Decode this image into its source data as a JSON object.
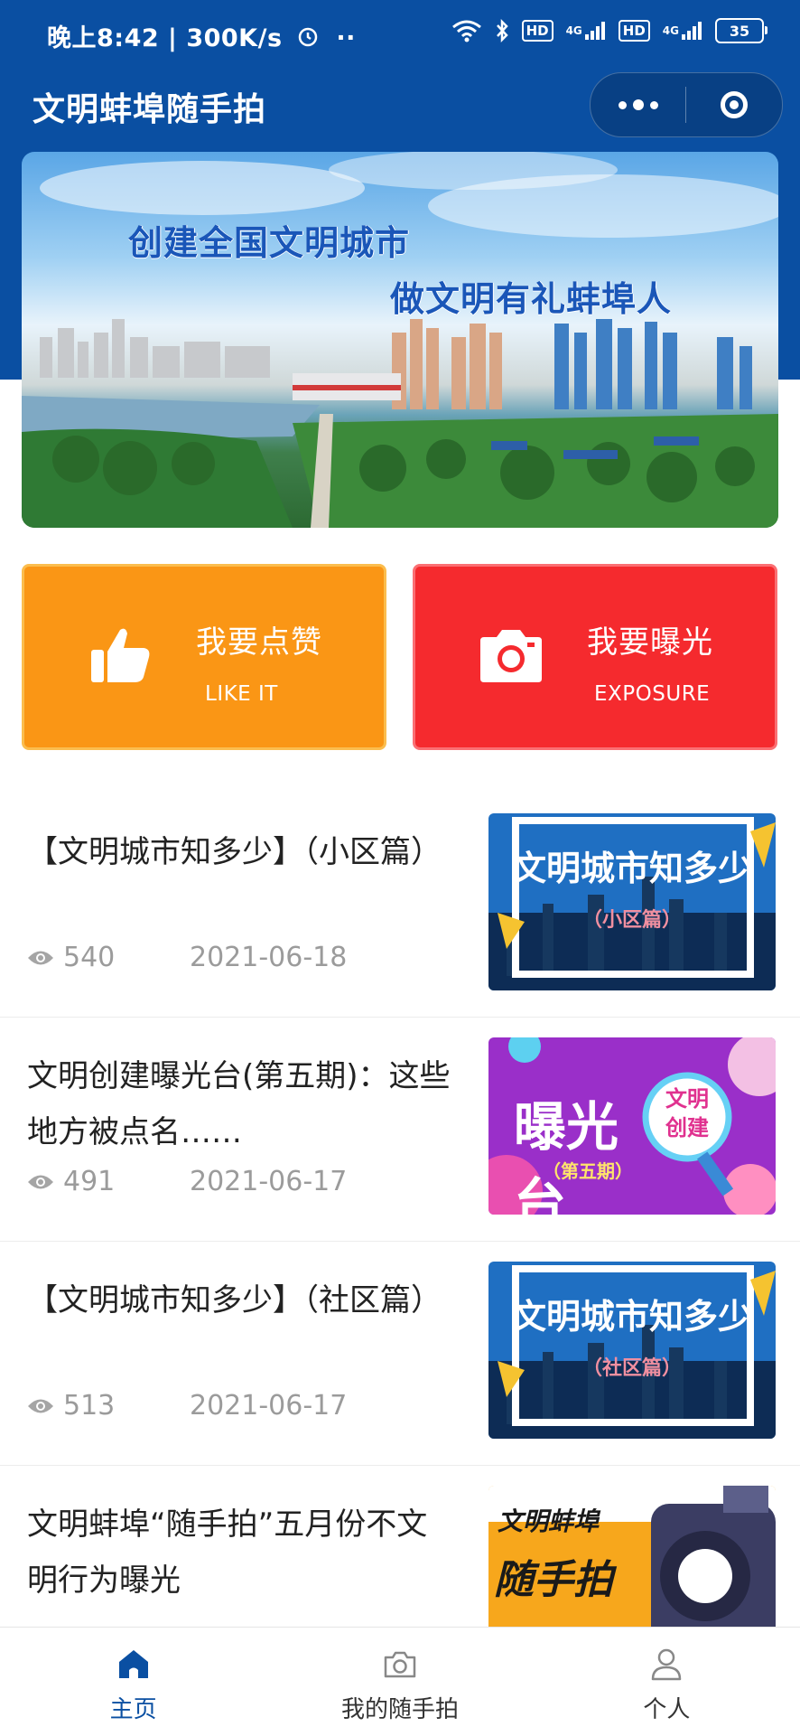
{
  "status_bar": {
    "time_speed": "晚上8:42 | 300K/s",
    "hd1": "HD",
    "hd2": "HD",
    "net1": "4G",
    "net2": "4G",
    "battery": "35"
  },
  "header": {
    "title": "文明蚌埠随手拍",
    "icons": [
      "more-icon",
      "close-miniprogram-icon"
    ]
  },
  "banner": {
    "line1": "创建全国文明城市",
    "line2": "做文明有礼蚌埠人"
  },
  "actions": [
    {
      "title": "我要点赞",
      "subtitle": "LIKE IT",
      "icon": "thumbs-up-icon",
      "color": "#fa9615"
    },
    {
      "title": "我要曝光",
      "subtitle": "EXPOSURE",
      "icon": "camera-icon",
      "color": "#f52a2e"
    }
  ],
  "articles": [
    {
      "title": "【文明城市知多少】（小区篇）",
      "views": "540",
      "date": "2021-06-18",
      "thumb_title": "文明城市知多少",
      "thumb_sub": "（小区篇）"
    },
    {
      "title": "文明创建曝光台(第五期)：这些地方被点名……",
      "views": "491",
      "date": "2021-06-17",
      "thumb_title": "曝光台",
      "thumb_sub": "（第五期）",
      "thumb_badge": "文明创建"
    },
    {
      "title": "【文明城市知多少】（社区篇）",
      "views": "513",
      "date": "2021-06-17",
      "thumb_title": "文明城市知多少",
      "thumb_sub": "（社区篇）"
    },
    {
      "title": "文明蚌埠“随手拍”五月份不文明行为曝光",
      "thumb_line1": "文明蚌埠",
      "thumb_line2": "随手拍"
    }
  ],
  "tabbar": [
    {
      "label": "主页",
      "icon": "home-icon",
      "active": true
    },
    {
      "label": "我的随手拍",
      "icon": "camera-icon",
      "active": false
    },
    {
      "label": "个人",
      "icon": "user-icon",
      "active": false
    }
  ],
  "colors": {
    "brand_blue": "#0a4fa2",
    "like_orange": "#fa9615",
    "expose_red": "#f52a2e",
    "meta_gray": "#9b9b9b"
  }
}
